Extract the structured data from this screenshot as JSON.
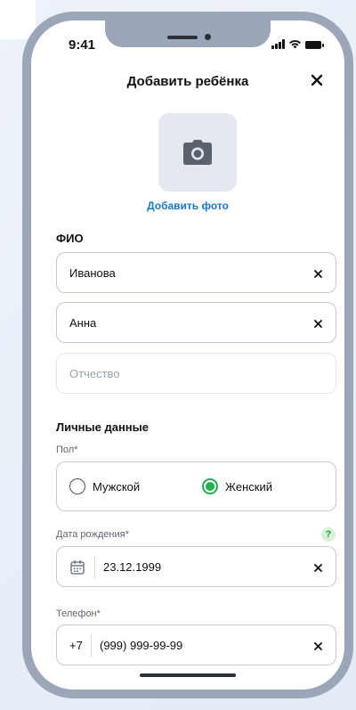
{
  "status_bar": {
    "time": "9:41"
  },
  "header": {
    "title": "Добавить ребёнка",
    "close_icon": "close-icon"
  },
  "photo": {
    "icon": "camera-icon",
    "add_label": "Добавить фото"
  },
  "fio": {
    "section_title": "ФИО",
    "last_name": {
      "value": "Иванова"
    },
    "first_name": {
      "value": "Анна"
    },
    "middle_name": {
      "placeholder": "Отчество"
    }
  },
  "personal": {
    "section_title": "Личные данные",
    "gender": {
      "label": "Пол*",
      "options": [
        {
          "label": "Мужской",
          "selected": false
        },
        {
          "label": "Женский",
          "selected": true
        }
      ]
    },
    "birth_date": {
      "label": "Дата рождения*",
      "help": "?",
      "value": "23.12.1999"
    },
    "phone": {
      "label": "Телефон*",
      "code": "+7",
      "value": "(999) 999-99-99"
    }
  },
  "colors": {
    "accent_green": "#22b14c",
    "link_blue": "#1976d2",
    "phone_frame": "#9ba6b8"
  }
}
